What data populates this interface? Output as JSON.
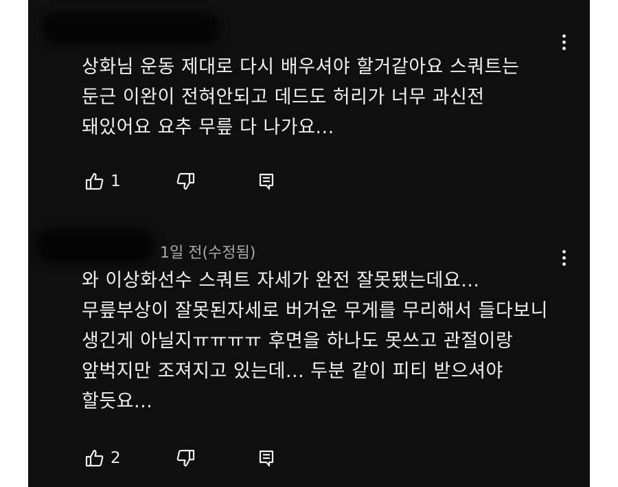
{
  "comments": [
    {
      "author": "",
      "meta": "",
      "text": "상화님 운동 제대로 다시 배우셔야 할거같아요 스쿼트는 둔근 이완이 전혀안되고 데드도 허리가 너무 과신전 돼있어요 요추 무릎 다 나가요...",
      "likes": "1"
    },
    {
      "author": "",
      "meta": "1일 전(수정됨)",
      "text": "와 이상화선수 스쿼트 자세가 완전 잘못됐는데요... 무릎부상이 잘못된자세로 버거운 무게를 무리해서 들다보니 생긴게 아닐지ㅠㅠㅠㅠ 후면을 하나도 못쓰고 관절이랑 앞벅지만 조져지고 있는데... 두분 같이 피티 받으셔야 할듯요...",
      "likes": "2"
    }
  ],
  "icons": {
    "like": "thumbs-up-icon",
    "dislike": "thumbs-down-icon",
    "reply": "reply-icon",
    "more": "more-vertical-icon"
  },
  "colors": {
    "background": "#0f0f0f",
    "text": "#f1f1f1",
    "meta": "#aaaaaa"
  }
}
